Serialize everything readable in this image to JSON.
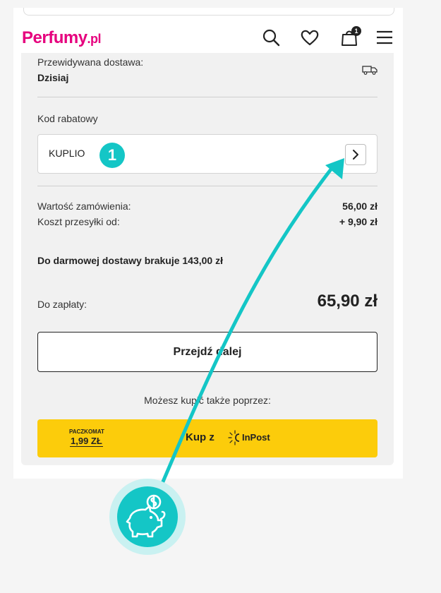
{
  "header": {
    "logo_main": "Perfumy",
    "logo_tld": ".pl",
    "icons": [
      "search-icon",
      "heart-icon",
      "cart-icon",
      "menu-icon"
    ],
    "cart_count": "1",
    "brand_color": "#e6007e"
  },
  "delivery": {
    "label": "Przewidywana dostawa:",
    "value": "Dzisiaj",
    "icon": "truck-icon"
  },
  "discount": {
    "label": "Kod rabatowy",
    "value": "KUPLIO",
    "apply_icon": "chevron-right-icon"
  },
  "annotation": {
    "step_number": "1",
    "accent_color": "#14c6c6",
    "icon": "piggy-bank-icon"
  },
  "summary": {
    "order_value_label": "Wartość zamówienia:",
    "order_value": "56,00 zł",
    "shipping_label": "Koszt przesyłki od:",
    "shipping_value": "+ 9,90 zł",
    "free_shipping_note": "Do darmowej dostawy brakuje 143,00 zł",
    "total_label": "Do zapłaty:",
    "total_value": "65,90 zł"
  },
  "actions": {
    "next_label": "Przejdź dalej",
    "alt_text": "Możesz kupić także poprzez:",
    "inpost": {
      "paczkomat_label": "PACZKOMAT",
      "paczkomat_price": "1,99 ZŁ",
      "cta": "Kup z",
      "brand": "InPost",
      "color": "#fccc0b"
    }
  }
}
